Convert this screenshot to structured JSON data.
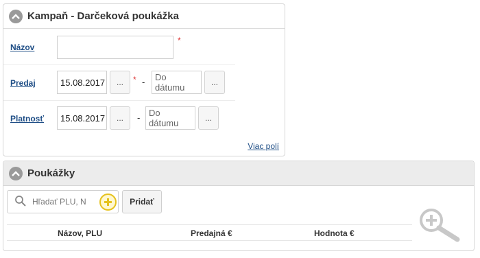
{
  "campaign_panel": {
    "title": "Kampaň - Darčeková poukážka",
    "collapse_icon": "chevron-up-icon",
    "fields": {
      "name": {
        "label": "Názov",
        "value": ""
      },
      "sale": {
        "label": "Predaj",
        "from_value": "15.08.2017",
        "to_placeholder": "Do dátumu",
        "picker_label": "..."
      },
      "validity": {
        "label": "Platnosť",
        "from_value": "15.08.2017",
        "to_placeholder": "Do dátumu",
        "picker_label": "..."
      }
    },
    "required_mark": "*",
    "range_separator": "-",
    "more_fields_link": "Viac polí"
  },
  "vouchers_panel": {
    "title": "Poukážky",
    "collapse_icon": "chevron-up-icon",
    "search": {
      "placeholder": "Hľadať PLU, N",
      "icon": "search-icon"
    },
    "add_icon": "plus-circle-icon",
    "add_button": "Pridať",
    "table": {
      "columns": [
        "Názov, PLU",
        "Predajná €",
        "Hodnota €"
      ]
    }
  },
  "zoom_icon": "zoom-in-icon",
  "colors": {
    "link": "#1f4e86",
    "required": "#dd3333",
    "accent_yellow": "#e6c21c",
    "header_gray": "#ececec"
  }
}
